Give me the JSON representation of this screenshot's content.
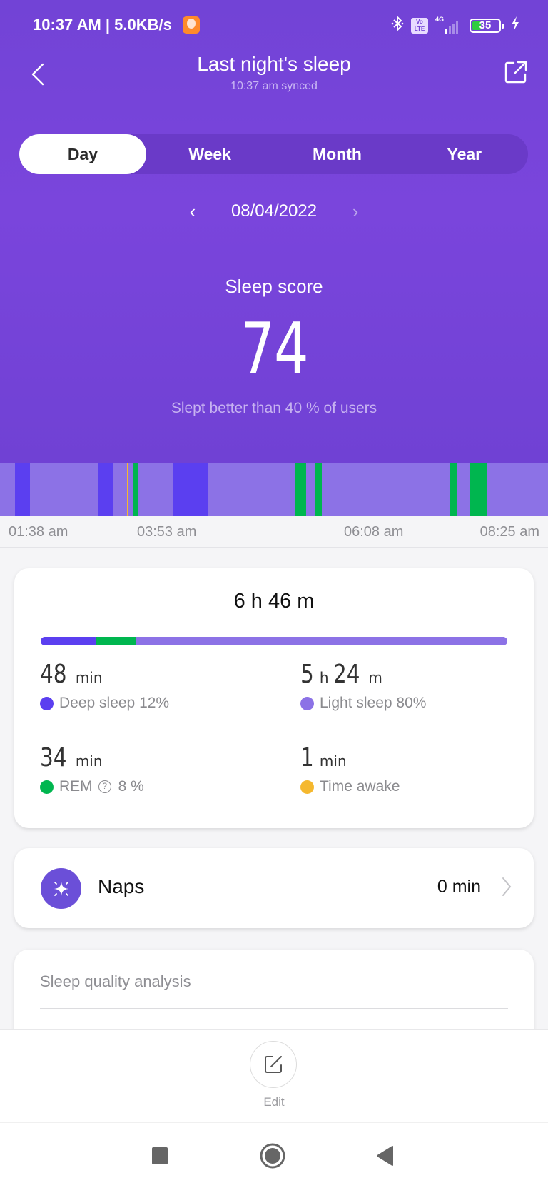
{
  "status_bar": {
    "time": "10:37 AM | 5.0KB/s",
    "network": "4G",
    "volte": "Vo LTE",
    "battery": "35",
    "icons": [
      "app-notification-icon",
      "bluetooth-icon",
      "volte-icon",
      "signal-icon",
      "battery-icon",
      "charging-icon"
    ]
  },
  "header": {
    "title": "Last night's sleep",
    "subtitle": "10:37 am synced",
    "back_icon": "chevron-left-icon",
    "share_icon": "share-icon"
  },
  "tabs": [
    {
      "label": "Day",
      "active": true
    },
    {
      "label": "Week",
      "active": false
    },
    {
      "label": "Month",
      "active": false
    },
    {
      "label": "Year",
      "active": false
    }
  ],
  "date_nav": {
    "date": "08/04/2022",
    "prev": "‹",
    "next": "›"
  },
  "score": {
    "label": "Sleep score",
    "value": "74",
    "comparison": "Slept better than 40 % of users"
  },
  "hypnogram": {
    "start": "01:38 am",
    "end": "08:25 am",
    "ticks": [
      "01:38 am",
      "03:53 am",
      "06:08 am",
      "08:25 am"
    ],
    "tick_fractions": [
      0,
      0.331,
      0.662,
      1.0
    ],
    "base_stage": "light",
    "segments": [
      {
        "stage": "deep",
        "start": 0.027,
        "end": 0.055
      },
      {
        "stage": "deep",
        "start": 0.18,
        "end": 0.207
      },
      {
        "stage": "awake",
        "start": 0.232,
        "end": 0.235
      },
      {
        "stage": "rem",
        "start": 0.242,
        "end": 0.252
      },
      {
        "stage": "deep",
        "start": 0.316,
        "end": 0.38
      },
      {
        "stage": "rem",
        "start": 0.538,
        "end": 0.558
      },
      {
        "stage": "rem",
        "start": 0.574,
        "end": 0.587
      },
      {
        "stage": "rem",
        "start": 0.822,
        "end": 0.835
      },
      {
        "stage": "rem",
        "start": 0.858,
        "end": 0.888
      }
    ]
  },
  "colors": {
    "deep": "#5b3ff0",
    "light": "#8c72e6",
    "rem": "#00b64f",
    "awake": "#f5b82e",
    "brand": "#7243d6"
  },
  "summary": {
    "total": "6 h 46 m",
    "breakdown_fractions": {
      "deep": 0.12,
      "rem": 0.084,
      "light": 0.795,
      "awake": 0.001
    },
    "stats": [
      {
        "key": "deep",
        "value_parts": [
          {
            "num": "48",
            "unit": "min"
          }
        ],
        "label": "Deep sleep 12%"
      },
      {
        "key": "light",
        "value_parts": [
          {
            "num": "5",
            "unit": "h"
          },
          {
            "num": "24",
            "unit": "m"
          }
        ],
        "label": "Light sleep 80%"
      },
      {
        "key": "rem",
        "value_parts": [
          {
            "num": "34",
            "unit": "min"
          }
        ],
        "label": "REM",
        "extra": "8 %"
      },
      {
        "key": "awake",
        "value_parts": [
          {
            "num": "1",
            "unit": "min"
          }
        ],
        "label": "Time awake"
      }
    ]
  },
  "naps": {
    "label": "Naps",
    "value": "0 min",
    "icon": "sparkle-icon"
  },
  "quality": {
    "title": "Sleep quality analysis"
  },
  "bottom": {
    "edit_label": "Edit"
  },
  "navbar": {
    "buttons": [
      "recents",
      "home",
      "back"
    ]
  }
}
